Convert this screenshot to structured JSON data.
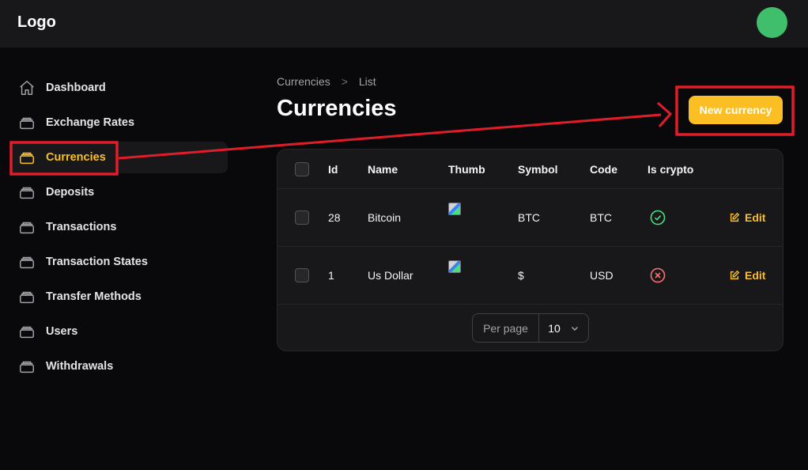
{
  "app": {
    "logo": "Logo"
  },
  "sidebar": {
    "items": [
      {
        "label": "Dashboard",
        "icon": "home-icon"
      },
      {
        "label": "Exchange Rates",
        "icon": "stack-icon"
      },
      {
        "label": "Currencies",
        "icon": "stack-icon",
        "active": true
      },
      {
        "label": "Deposits",
        "icon": "stack-icon"
      },
      {
        "label": "Transactions",
        "icon": "stack-icon"
      },
      {
        "label": "Transaction States",
        "icon": "stack-icon"
      },
      {
        "label": "Transfer Methods",
        "icon": "stack-icon"
      },
      {
        "label": "Users",
        "icon": "stack-icon"
      },
      {
        "label": "Withdrawals",
        "icon": "stack-icon"
      }
    ]
  },
  "breadcrumb": {
    "parent": "Currencies",
    "separator": ">",
    "current": "List"
  },
  "page": {
    "title": "Currencies",
    "new_button": "New currency"
  },
  "table": {
    "columns": [
      "Id",
      "Name",
      "Thumb",
      "Symbol",
      "Code",
      "Is crypto"
    ],
    "rows": [
      {
        "id": "28",
        "name": "Bitcoin",
        "symbol": "BTC",
        "code": "BTC",
        "is_crypto": true,
        "action": "Edit"
      },
      {
        "id": "1",
        "name": "Us Dollar",
        "symbol": "$",
        "code": "USD",
        "is_crypto": false,
        "action": "Edit"
      }
    ]
  },
  "pagination": {
    "per_page_label": "Per page",
    "per_page_value": "10"
  },
  "colors": {
    "accent": "#fbbf24",
    "annotation": "#e11d2a",
    "success": "#4ade80",
    "danger": "#f87171"
  }
}
